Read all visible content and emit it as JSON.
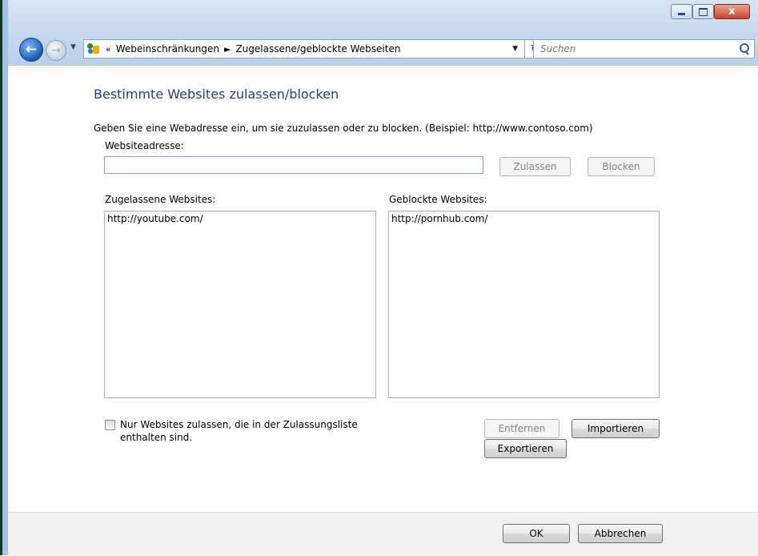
{
  "window": {
    "close_glyph": "x"
  },
  "nav": {
    "back_glyph": "←",
    "forward_glyph": "→",
    "history_glyph": "▼"
  },
  "address_bar": {
    "overflow_glyph": "«",
    "breadcrumb": [
      "Webeinschränkungen",
      "Zugelassene/geblockte Webseiten"
    ],
    "separator": "►",
    "dropdown_glyph": "▼",
    "refresh_glyph": "↻"
  },
  "search": {
    "placeholder": "Suchen"
  },
  "page": {
    "title": "Bestimmte Websites zulassen/blocken",
    "instruction": "Geben Sie eine Webadresse ein, um sie zuzulassen oder zu blocken. (Beispiel: http://www.contoso.com)",
    "address_label": "Websiteadresse:",
    "address_value": "",
    "allow_button": "Zulassen",
    "block_button": "Blocken",
    "allowed_label": "Zugelassene Websites:",
    "blocked_label": "Geblockte Websites:",
    "allowed_sites": [
      "http://youtube.com/"
    ],
    "blocked_sites": [
      "http://pornhub.com/"
    ],
    "checkbox_label": "Nur Websites zulassen, die in der Zulassungsliste enthalten sind.",
    "checkbox_checked": false,
    "remove_button": "Entfernen",
    "import_button": "Importieren",
    "export_button": "Exportieren"
  },
  "footer": {
    "ok_button": "OK",
    "cancel_button": "Abbrechen"
  },
  "colors": {
    "title": "#1e3f95",
    "frame": "#c7daee"
  },
  "icons": {
    "window_icon": "parental-controls-icon",
    "search_icon": "magnifier-icon"
  }
}
